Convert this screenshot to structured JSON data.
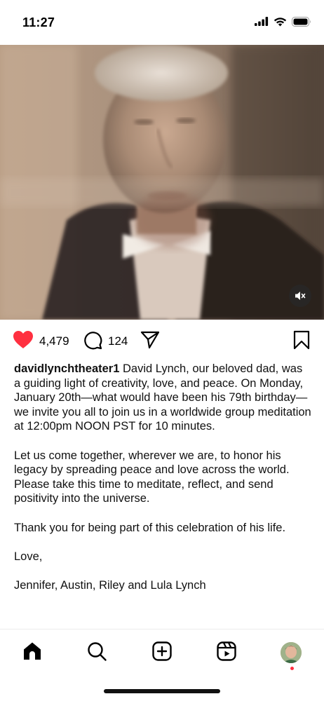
{
  "status_bar": {
    "time": "11:27",
    "icons": [
      "signal-icon",
      "wifi-icon",
      "battery-icon"
    ]
  },
  "post": {
    "media": {
      "description_icon": "photo",
      "mute_icon": "speaker-muted-icon"
    },
    "likes": "4,479",
    "comments": "124",
    "like_color": "#ff3040",
    "username": "davidlynchtheater1",
    "caption_lead": "David Lynch, our beloved dad, was a guiding light of creativity, love, and peace. On Monday, January 20th—what would have been his 79th birthday—we invite you all to join us in a worldwide group meditation at 12:00pm NOON PST for 10 minutes.",
    "caption_paragraphs": [
      "Let us come together, wherever we are, to honor his legacy by spreading peace and love across the world. Please take this time to meditate, reflect, and send positivity into the universe.",
      "Thank you for being part of this celebration of his life.",
      "Love,",
      "Jennifer, Austin, Riley and Lula Lynch"
    ]
  },
  "nav": {
    "items": [
      "home-icon",
      "search-icon",
      "create-icon",
      "reels-icon",
      "profile-avatar"
    ]
  }
}
